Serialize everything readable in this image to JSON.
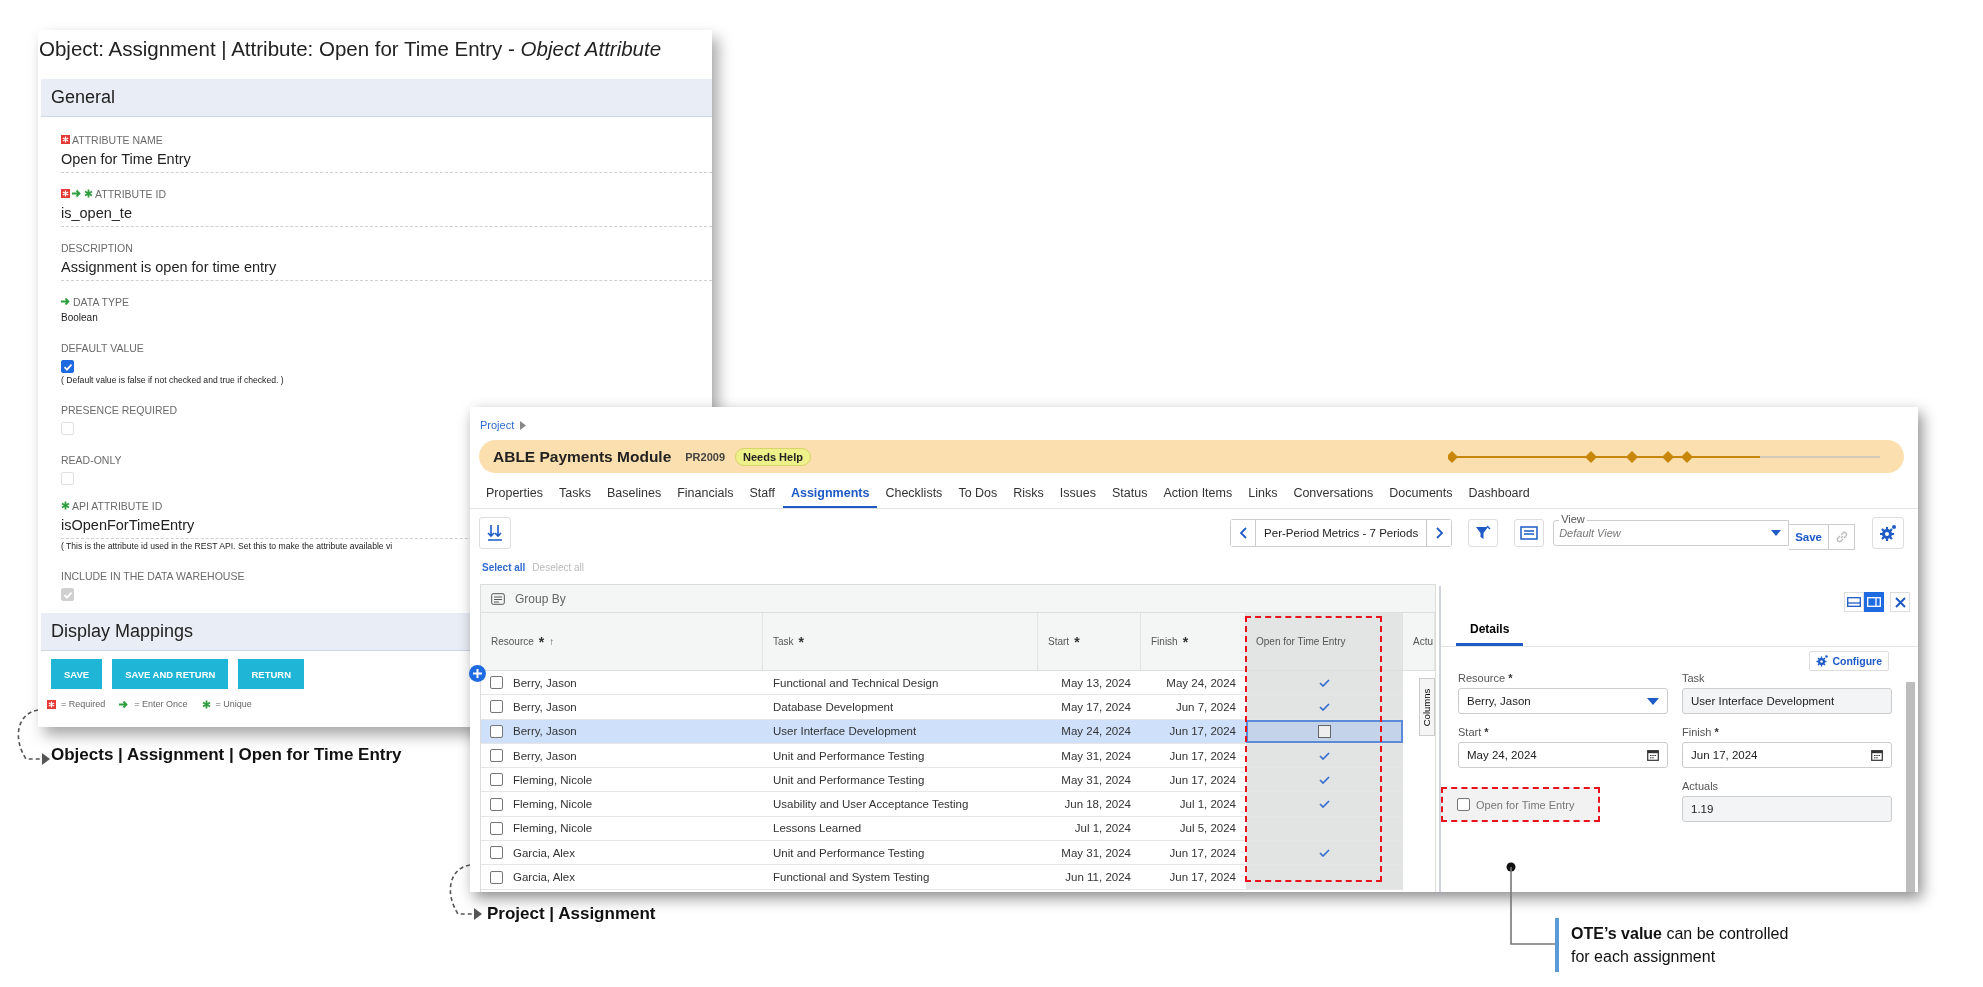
{
  "attribute_window": {
    "title": "Object: Assignment | Attribute: Open for Time Entry - *Object Attribute*",
    "general_heading": "General",
    "fields": [
      {
        "kind": "text",
        "label": "ATTRIBUTE NAME",
        "required": true,
        "value": "Open for Time Entry"
      },
      {
        "kind": "text",
        "label": "ATTRIBUTE ID",
        "required": true,
        "enter_once": true,
        "unique": true,
        "value": "is_open_te"
      },
      {
        "kind": "text",
        "label": "DESCRIPTION",
        "value": "Assignment is open for time entry"
      },
      {
        "kind": "plain",
        "label": "DATA TYPE",
        "enter_once": true,
        "value": "Boolean"
      },
      {
        "kind": "checkbox",
        "label": "DEFAULT VALUE",
        "checked": true,
        "disabled": false,
        "note": "( Default value is false if not checked and true if checked. )"
      },
      {
        "kind": "checkbox",
        "label": "PRESENCE REQUIRED",
        "checked": false,
        "disabled": true
      },
      {
        "kind": "checkbox",
        "label": "READ-ONLY",
        "checked": false,
        "disabled": true
      },
      {
        "kind": "text",
        "label": "API ATTRIBUTE ID",
        "unique": true,
        "value": "isOpenForTimeEntry",
        "note": "( This is the attribute id used in the REST API. Set this to make the attribute available vi"
      },
      {
        "kind": "checkbox",
        "label": "INCLUDE IN THE DATA WAREHOUSE",
        "checked": true,
        "disabled": true
      }
    ],
    "mappings_heading": "Display Mappings",
    "buttons": [
      "SAVE",
      "SAVE AND RETURN",
      "RETURN"
    ],
    "legend": [
      {
        "kind": "required",
        "text": "= Required"
      },
      {
        "kind": "enter_once",
        "text": "= Enter Once"
      },
      {
        "kind": "unique",
        "text": "= Unique"
      }
    ]
  },
  "caption_objects": "Objects | Assignment | Open for Time Entry",
  "project_window": {
    "breadcrumb": "Project",
    "project_name": "ABLE Payments Module",
    "project_code": "PR2009",
    "status_badge": "Needs Help",
    "tabs": [
      {
        "label": "Properties",
        "selected": false
      },
      {
        "label": "Tasks",
        "selected": false
      },
      {
        "label": "Baselines",
        "selected": false
      },
      {
        "label": "Financials",
        "selected": false
      },
      {
        "label": "Staff",
        "selected": false
      },
      {
        "label": "Assignments",
        "selected": true
      },
      {
        "label": "Checklists",
        "selected": false
      },
      {
        "label": "To Dos",
        "selected": false
      },
      {
        "label": "Risks",
        "selected": false
      },
      {
        "label": "Issues",
        "selected": false
      },
      {
        "label": "Status",
        "selected": false
      },
      {
        "label": "Action Items",
        "selected": false
      },
      {
        "label": "Links",
        "selected": false
      },
      {
        "label": "Conversations",
        "selected": false
      },
      {
        "label": "Documents",
        "selected": false
      },
      {
        "label": "Dashboard",
        "selected": false
      }
    ],
    "period_selector": "Per-Period Metrics - 7 Periods",
    "view_legend": "View",
    "view_placeholder": "Default View",
    "save_label": "Save",
    "select_all": "Select all",
    "deselect_all": "Deselect all",
    "group_by": "Group By",
    "columns": [
      {
        "label": "Resource",
        "required_mark": "*",
        "sort_mark": "↑"
      },
      {
        "label": "Task",
        "required_mark": "*"
      },
      {
        "label": "Start",
        "required_mark": "*"
      },
      {
        "label": "Finish",
        "required_mark": "*"
      },
      {
        "label": "Open for Time Entry"
      },
      {
        "label": "Actu"
      }
    ],
    "rows": [
      {
        "resource": "Berry, Jason",
        "task": "Functional and Technical Design",
        "start": "May 13, 2024",
        "finish": "May 24, 2024",
        "open_for_time_entry": true,
        "selected": false
      },
      {
        "resource": "Berry, Jason",
        "task": "Database Development",
        "start": "May 17, 2024",
        "finish": "Jun 7, 2024",
        "open_for_time_entry": true,
        "selected": false
      },
      {
        "resource": "Berry, Jason",
        "task": "User Interface Development",
        "start": "May 24, 2024",
        "finish": "Jun 17, 2024",
        "open_for_time_entry": false,
        "selected": true
      },
      {
        "resource": "Berry, Jason",
        "task": "Unit and Performance Testing",
        "start": "May 31, 2024",
        "finish": "Jun 17, 2024",
        "open_for_time_entry": true,
        "selected": false
      },
      {
        "resource": "Fleming, Nicole",
        "task": "Unit and Performance Testing",
        "start": "May 31, 2024",
        "finish": "Jun 17, 2024",
        "open_for_time_entry": true,
        "selected": false
      },
      {
        "resource": "Fleming, Nicole",
        "task": "Usability and User Acceptance Testing",
        "start": "Jun 18, 2024",
        "finish": "Jul 1, 2024",
        "open_for_time_entry": true,
        "selected": false
      },
      {
        "resource": "Fleming, Nicole",
        "task": "Lessons Learned",
        "start": "Jul 1, 2024",
        "finish": "Jul 5, 2024",
        "open_for_time_entry": false,
        "selected": false
      },
      {
        "resource": "Garcia, Alex",
        "task": "Unit and Performance Testing",
        "start": "May 31, 2024",
        "finish": "Jun 17, 2024",
        "open_for_time_entry": true,
        "selected": false
      },
      {
        "resource": "Garcia, Alex",
        "task": "Functional and System Testing",
        "start": "Jun 11, 2024",
        "finish": "Jun 17, 2024",
        "open_for_time_entry": false,
        "selected": false
      }
    ],
    "columns_tab": "Columns",
    "details": {
      "tab": "Details",
      "configure": "Configure",
      "resource_label": "Resource",
      "resource_mark": "*",
      "resource_value": "Berry, Jason",
      "task_label": "Task",
      "task_value": "User Interface Development",
      "start_label": "Start",
      "start_mark": "*",
      "start_value": "May 24, 2024",
      "finish_label": "Finish",
      "finish_mark": "*",
      "finish_value": "Jun 17, 2024",
      "actuals_label": "Actuals",
      "actuals_value": "1.19",
      "ote_label": "Open for Time Entry",
      "ote_checked": false
    }
  },
  "caption_project": "Project | Assignment",
  "callout": "**OTE’s value** can be controlled for each assignment"
}
